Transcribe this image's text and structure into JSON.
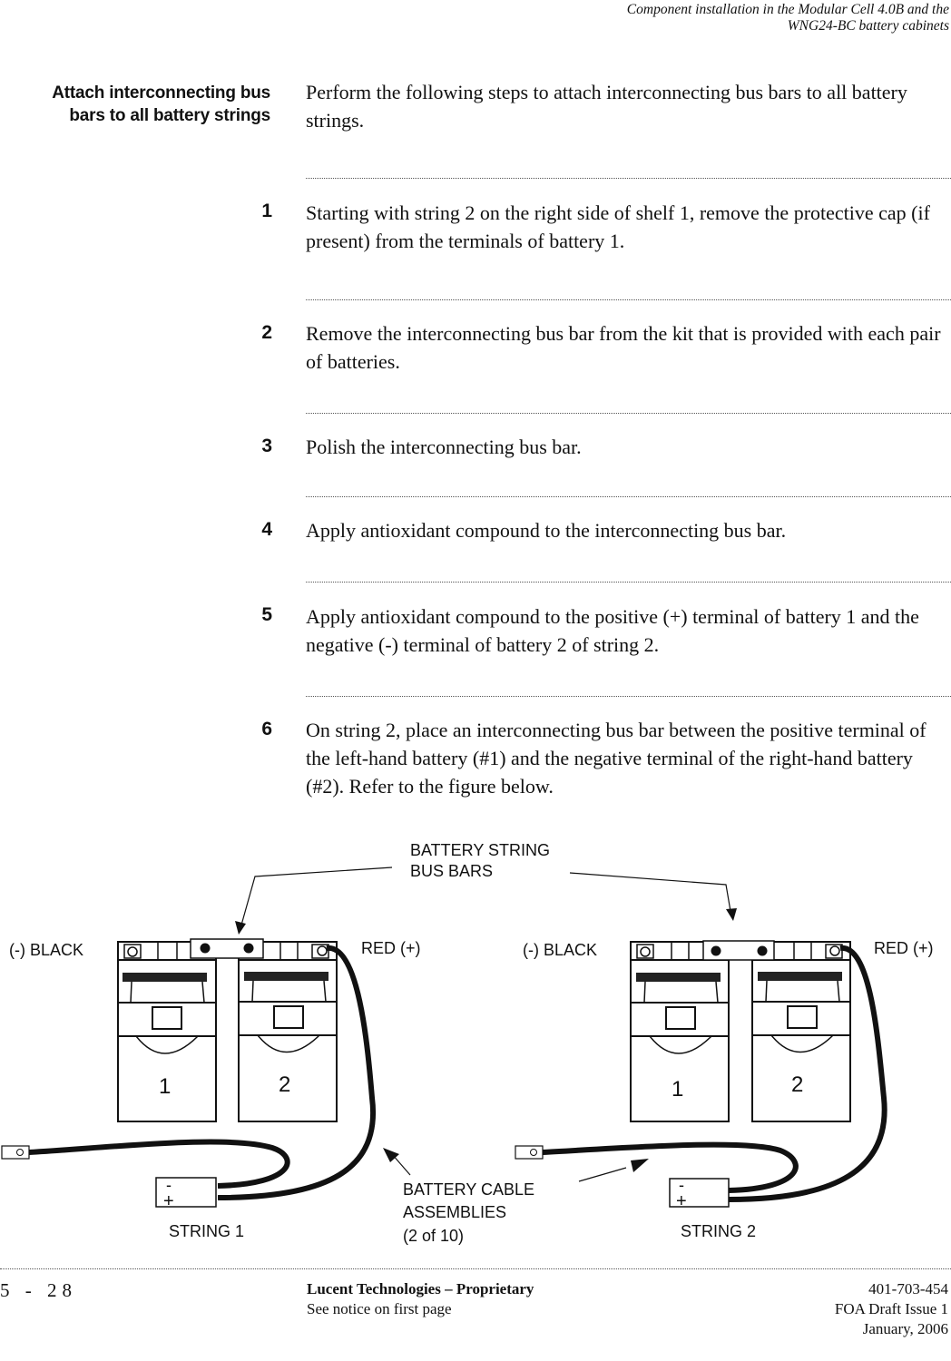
{
  "header": {
    "line1": "Component installation in the Modular Cell 4.0B and the",
    "line2": "WNG24-BC battery cabinets"
  },
  "section": {
    "title_line1": "Attach interconnecting bus",
    "title_line2": "bars to all battery strings",
    "intro": "Perform the following steps to attach interconnecting bus bars to all battery strings."
  },
  "steps": [
    {
      "num": "1",
      "text": "Starting with string 2 on the right side of shelf 1, remove the protective cap (if present) from the terminals of battery 1."
    },
    {
      "num": "2",
      "text": "Remove the interconnecting bus bar from the kit that is provided with each pair of batteries."
    },
    {
      "num": "3",
      "text": "Polish the interconnecting bus bar."
    },
    {
      "num": "4",
      "text": "Apply antioxidant compound to the interconnecting bus bar."
    },
    {
      "num": "5",
      "text": "Apply antioxidant compound to the positive (+) terminal of battery 1 and the negative (-) terminal of battery 2 of string 2."
    },
    {
      "num": "6",
      "text": "On string 2, place an interconnecting bus bar between the positive terminal of the left-hand battery (#1) and the negative terminal of the right-hand battery (#2). Refer to the figure below."
    }
  ],
  "figure": {
    "bus_bars_label_1": "BATTERY STRING",
    "bus_bars_label_2": "BUS BARS",
    "cable_label_1": "BATTERY CABLE",
    "cable_label_2": "ASSEMBLIES",
    "cable_label_3": "(2 of 10)",
    "strings": [
      {
        "name": "STRING 1",
        "neg_label": "(-) BLACK",
        "pos_label": "RED (+)",
        "battery_1": "1",
        "battery_2": "2",
        "minus": "-",
        "plus": "+"
      },
      {
        "name": "STRING 2",
        "neg_label": "(-) BLACK",
        "pos_label": "RED (+)",
        "battery_1": "1",
        "battery_2": "2",
        "minus": "-",
        "plus": "+"
      }
    ]
  },
  "footer": {
    "page": "5 - 28",
    "company": "Lucent Technologies – Proprietary",
    "notice": "See notice on first page",
    "doc_number": "401-703-454",
    "issue": "FOA Draft Issue 1",
    "date": "January, 2006"
  }
}
